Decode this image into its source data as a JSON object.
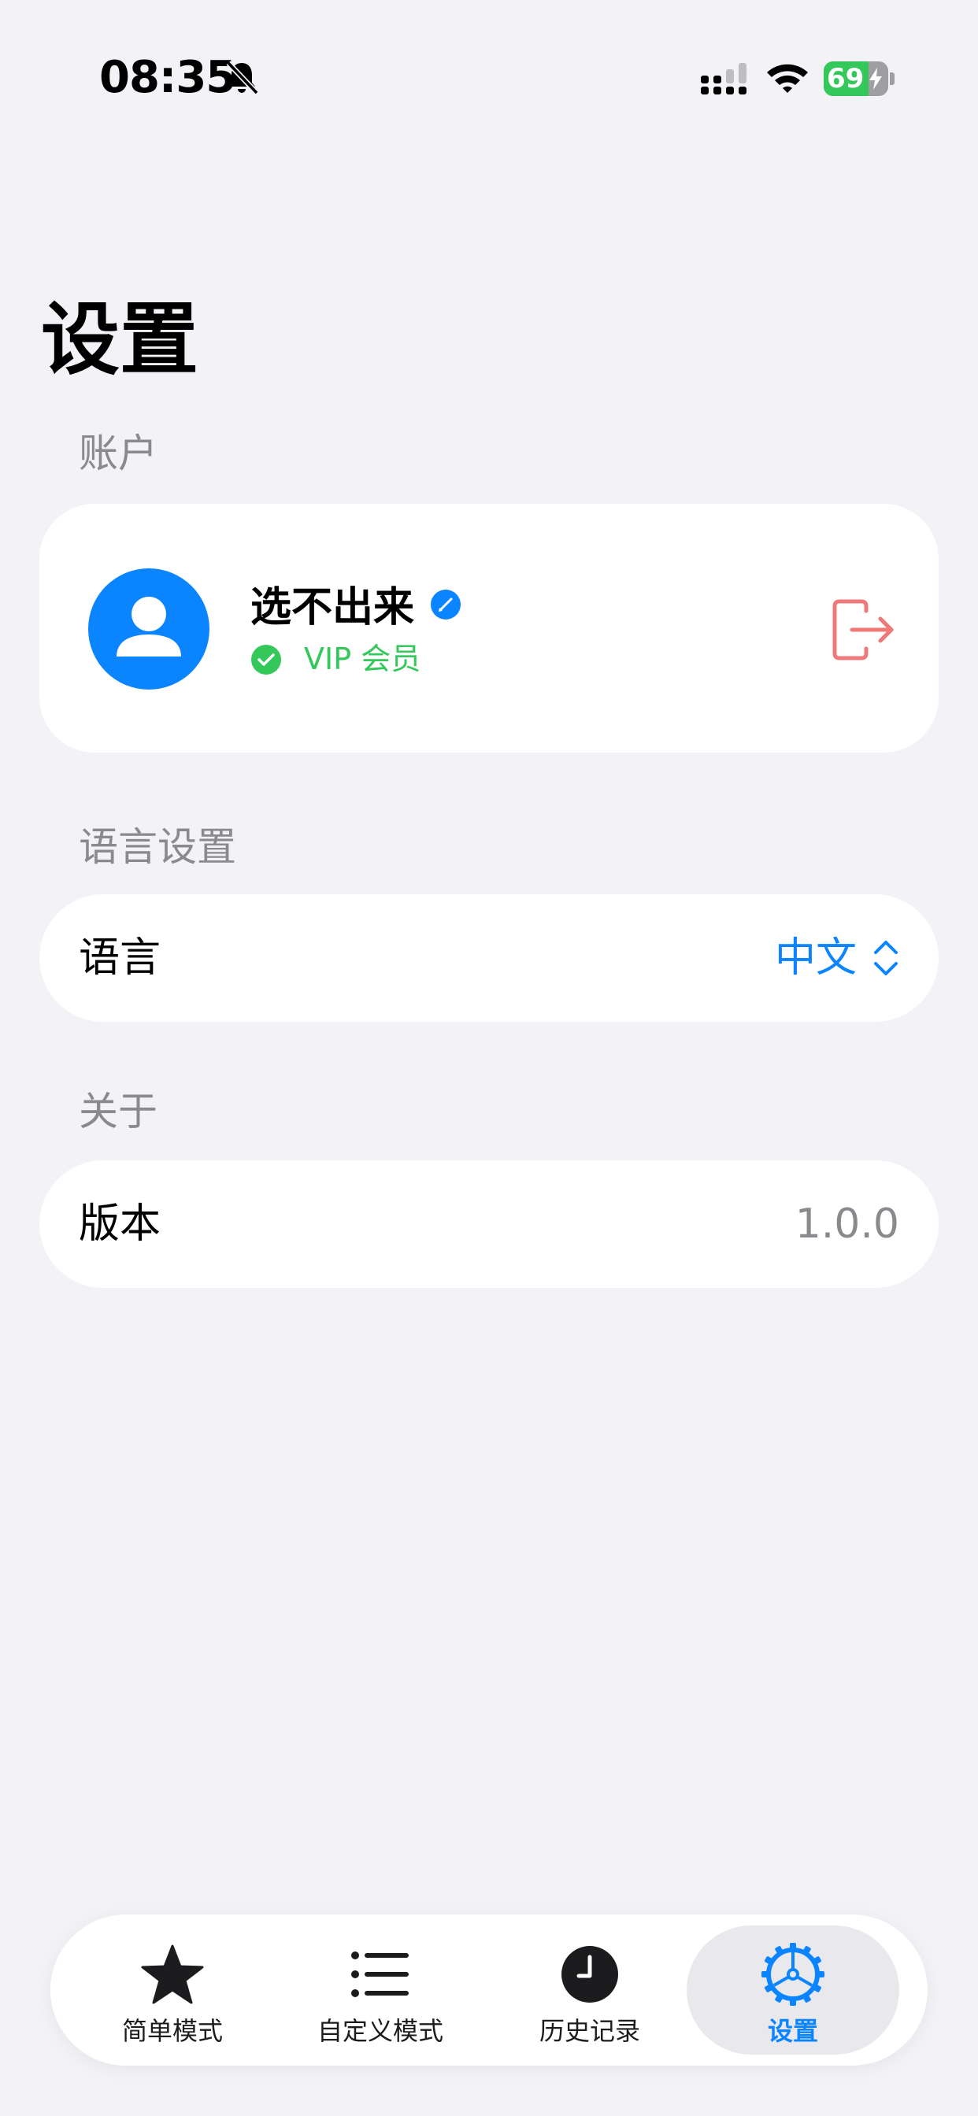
{
  "status_bar": {
    "time": "08:35",
    "battery_level": "69",
    "battery_fraction": 0.69,
    "icons": [
      "bell-slash-icon",
      "signal-icon",
      "wifi-icon",
      "battery-charging-icon"
    ]
  },
  "page": {
    "title": "设置"
  },
  "account": {
    "section_title": "账户",
    "username": "选不出来",
    "membership": "VIP 会员",
    "icons": [
      "person-avatar-icon",
      "edit-pencil-icon",
      "check-circle-icon",
      "logout-icon"
    ]
  },
  "language": {
    "section_title": "语言设置",
    "row_label": "语言",
    "selected_value": "中文"
  },
  "about": {
    "section_title": "关于",
    "row_label": "版本",
    "version": "1.0.0"
  },
  "tab_bar": {
    "tabs": [
      {
        "label": "简单模式",
        "icon": "star-icon",
        "active": false
      },
      {
        "label": "自定义模式",
        "icon": "list-icon",
        "active": false
      },
      {
        "label": "历史记录",
        "icon": "clock-icon",
        "active": false
      },
      {
        "label": "设置",
        "icon": "gear-icon",
        "active": true
      }
    ]
  },
  "colors": {
    "accent": "#0A84FF",
    "success": "#34C759",
    "danger": "#F07878",
    "background": "#F2F2F7",
    "secondary_text": "#8A8A8E"
  }
}
